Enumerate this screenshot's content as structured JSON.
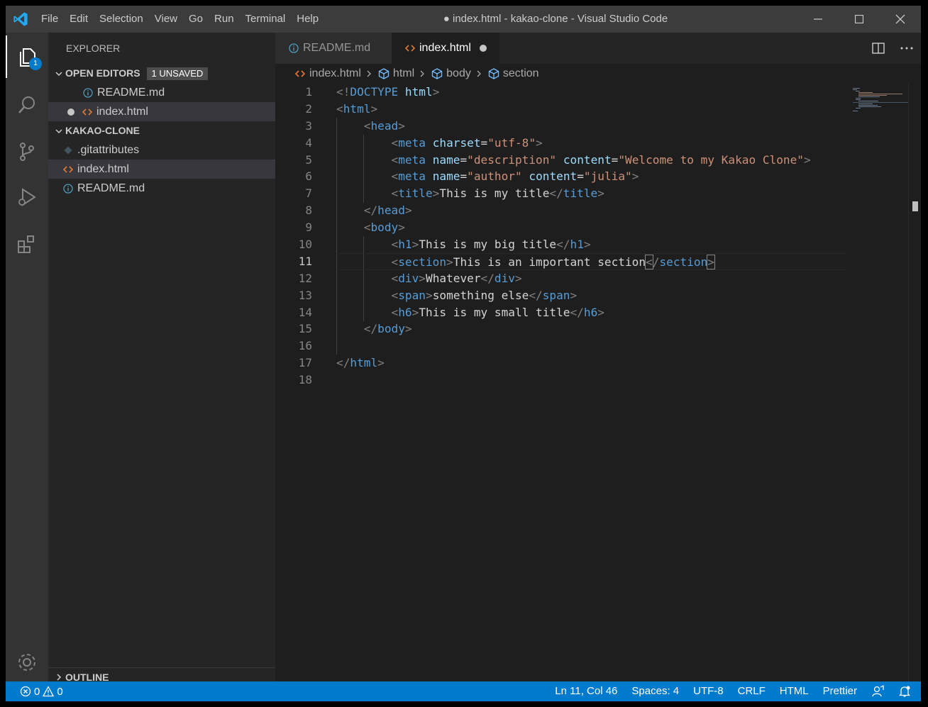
{
  "window": {
    "title": "● index.html - kakao-clone - Visual Studio Code",
    "menu": [
      "File",
      "Edit",
      "Selection",
      "View",
      "Go",
      "Run",
      "Terminal",
      "Help"
    ]
  },
  "activity_bar": {
    "items": [
      {
        "name": "explorer",
        "icon": "files-icon",
        "badge": "1"
      },
      {
        "name": "search",
        "icon": "search-icon"
      },
      {
        "name": "source-control",
        "icon": "source-control-icon"
      },
      {
        "name": "run-debug",
        "icon": "run-debug-icon"
      },
      {
        "name": "extensions",
        "icon": "extensions-icon"
      }
    ],
    "bottom": {
      "name": "manage",
      "icon": "gear-icon"
    }
  },
  "sidebar": {
    "title": "EXPLORER",
    "open_editors": {
      "label": "OPEN EDITORS",
      "badge": "1 UNSAVED",
      "items": [
        {
          "label": "README.md",
          "icon": "info-icon",
          "dirty": false
        },
        {
          "label": "index.html",
          "icon": "html-icon",
          "dirty": true
        }
      ]
    },
    "folder": {
      "label": "KAKAO-CLONE",
      "items": [
        {
          "label": ".gitattributes",
          "icon": "git-icon"
        },
        {
          "label": "index.html",
          "icon": "html-icon",
          "selected": true
        },
        {
          "label": "README.md",
          "icon": "info-icon"
        }
      ]
    },
    "outline": {
      "label": "OUTLINE"
    }
  },
  "tabs": [
    {
      "label": "README.md",
      "icon": "info-icon",
      "active": false
    },
    {
      "label": "index.html",
      "icon": "html-icon",
      "active": true,
      "dirty": true
    }
  ],
  "breadcrumbs": [
    "index.html",
    "html",
    "body",
    "section"
  ],
  "editor": {
    "line_numbers": [
      "1",
      "2",
      "3",
      "4",
      "5",
      "6",
      "7",
      "8",
      "9",
      "10",
      "11",
      "12",
      "13",
      "14",
      "15",
      "16",
      "17",
      "18"
    ],
    "current_line": 11
  },
  "status_bar": {
    "errors": "0",
    "warnings": "0",
    "position": "Ln 11, Col 46",
    "spaces": "Spaces: 4",
    "encoding": "UTF-8",
    "eol": "CRLF",
    "language": "HTML",
    "formatter": "Prettier"
  },
  "colors": {
    "accent": "#007acc",
    "tag": "#569cd6",
    "attribute": "#9cdcfe",
    "string": "#ce9178",
    "html_icon": "#e37933",
    "info_icon": "#519aba"
  }
}
